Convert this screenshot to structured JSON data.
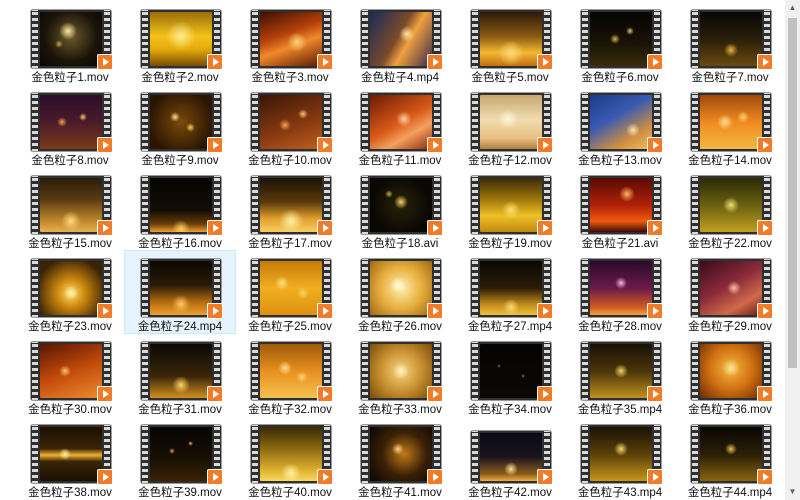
{
  "files": [
    {
      "name": "金色粒子1.mov",
      "theme": "heart-outline"
    },
    {
      "name": "金色粒子2.mov",
      "theme": "gold-glow"
    },
    {
      "name": "金色粒子3.mov",
      "theme": "orange-waves"
    },
    {
      "name": "金色粒子4.mp4",
      "theme": "blue-gold-burst"
    },
    {
      "name": "金色粒子5.mov",
      "theme": "falling-sparks"
    },
    {
      "name": "金色粒子6.mov",
      "theme": "dark-sparks"
    },
    {
      "name": "金色粒子7.mov",
      "theme": "dark-glitter"
    },
    {
      "name": "金色粒子8.mov",
      "theme": "purple-bokeh"
    },
    {
      "name": "金色粒子9.mov",
      "theme": "gold-stars"
    },
    {
      "name": "金色粒子10.mov",
      "theme": "brown-bokeh"
    },
    {
      "name": "金色粒子11.mov",
      "theme": "orange-silk"
    },
    {
      "name": "金色粒子12.mov",
      "theme": "pale-gold"
    },
    {
      "name": "金色粒子13.mov",
      "theme": "blue-gold"
    },
    {
      "name": "金色粒子14.mov",
      "theme": "orange-bokeh"
    },
    {
      "name": "金色粒子15.mov",
      "theme": "dark-fountain"
    },
    {
      "name": "金色粒子16.mov",
      "theme": "dark-horizon"
    },
    {
      "name": "金色粒子17.mov",
      "theme": "gold-floor"
    },
    {
      "name": "金色粒子18.avi",
      "theme": "dark-heart"
    },
    {
      "name": "金色粒子19.mov",
      "theme": "gold-rain"
    },
    {
      "name": "金色粒子21.avi",
      "theme": "red-spotlight"
    },
    {
      "name": "金色粒子22.mov",
      "theme": "olive-rain"
    },
    {
      "name": "金色粒子23.mov",
      "theme": "gold-rays"
    },
    {
      "name": "金色粒子24.mp4",
      "theme": "gold-grass"
    },
    {
      "name": "金色粒子25.mov",
      "theme": "gold-bokeh"
    },
    {
      "name": "金色粒子26.mov",
      "theme": "bright-bokeh"
    },
    {
      "name": "金色粒子27.mp4",
      "theme": "dark-gold-dust"
    },
    {
      "name": "金色粒子28.mov",
      "theme": "purple-stage"
    },
    {
      "name": "金色粒子29.mov",
      "theme": "pink-swirl"
    },
    {
      "name": "金色粒子30.mov",
      "theme": "orange-branches"
    },
    {
      "name": "金色粒子31.mov",
      "theme": "dark-burst"
    },
    {
      "name": "金色粒子32.mov",
      "theme": "amber-bokeh"
    },
    {
      "name": "金色粒子33.mov",
      "theme": "gold-sparkle"
    },
    {
      "name": "金色粒子34.mov",
      "theme": "black-dots"
    },
    {
      "name": "金色粒子35.mp4",
      "theme": "gold-strings"
    },
    {
      "name": "金色粒子36.mov",
      "theme": "orange-glow"
    },
    {
      "name": "金色粒子38.mov",
      "theme": "gold-flare"
    },
    {
      "name": "金色粒子39.mov",
      "theme": "dark-stars"
    },
    {
      "name": "金色粒子40.mov",
      "theme": "gold-ground"
    },
    {
      "name": "金色粒子41.mov",
      "theme": "comet-swirl"
    },
    {
      "name": "金色粒子42.mov",
      "theme": "dark-light-beam"
    },
    {
      "name": "金色粒子43.mp4",
      "theme": "gold-curtain"
    },
    {
      "name": "金色粒子44.mp4",
      "theme": "dark-curtain"
    }
  ],
  "selected_index": 22,
  "colors": {
    "selection_bg": "#e5f3ff",
    "play_badge": "#f07c2a",
    "filmstrip": "#2f2f2f"
  },
  "icons": {
    "play": "play-badge-icon",
    "scroll_up": "chevron-up-icon",
    "scroll_down": "chevron-down-icon"
  }
}
